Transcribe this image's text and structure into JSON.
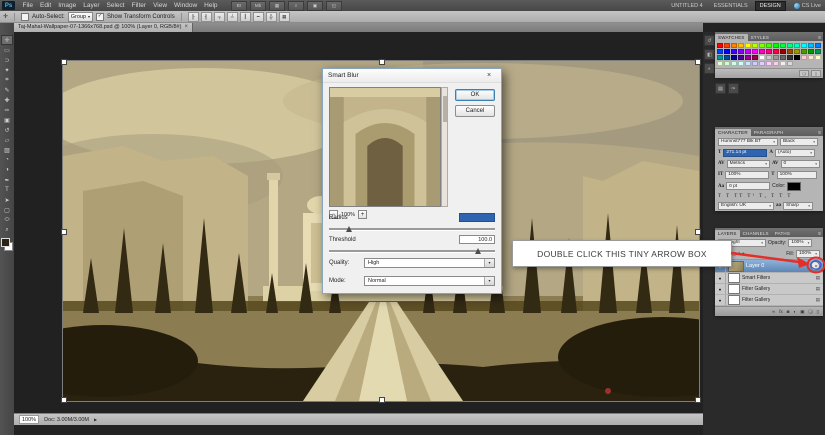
{
  "icons": {
    "eye": "●",
    "dropdown": "▾",
    "check": "✓",
    "smart_filter_toggle": "»",
    "panel_menu": "≡",
    "status_arrow": "▶",
    "slider_row_icon": "▤"
  },
  "app": {
    "logo": "Ps",
    "menus": [
      "File",
      "Edit",
      "Image",
      "Layer",
      "Select",
      "Filter",
      "View",
      "Window",
      "Help"
    ],
    "appbar_icons": [
      {
        "name": "bridge-icon",
        "glyph": "Br"
      },
      {
        "name": "mini-bridge-icon",
        "glyph": "Mb"
      },
      {
        "name": "view-extras-icon",
        "glyph": "▦"
      },
      {
        "name": "zoom-tool-icon",
        "glyph": "⌕"
      },
      {
        "name": "arrange-documents-icon",
        "glyph": "▣"
      },
      {
        "name": "screen-mode-icon",
        "glyph": "◱"
      }
    ],
    "workspace_tabs": [
      "UNTITLED 4",
      "ESSENTIALS",
      "DESIGN"
    ],
    "cs_live": "CS Live"
  },
  "options": {
    "auto_select_label": "Auto-Select:",
    "auto_select_value": "Group",
    "show_transform_label": "Show Transform Controls",
    "align_icons": [
      "╟",
      "╢",
      "╤",
      "╧",
      "┃",
      "━",
      "╬",
      "▦"
    ]
  },
  "doc_tab": {
    "title": "Taj-Mahal-Wallpaper-07-1366x768.psd @ 100% (Layer 0, RGB/8#)",
    "close": "×"
  },
  "tools": [
    {
      "name": "move-tool-icon",
      "glyph": "✛"
    },
    {
      "name": "rectangular-marquee-tool-icon",
      "glyph": "▭"
    },
    {
      "name": "lasso-tool-icon",
      "glyph": "⊃"
    },
    {
      "name": "quick-selection-tool-icon",
      "glyph": "✦"
    },
    {
      "name": "crop-tool-icon",
      "glyph": "⌗"
    },
    {
      "name": "eyedropper-tool-icon",
      "glyph": "✎"
    },
    {
      "name": "healing-brush-tool-icon",
      "glyph": "✚"
    },
    {
      "name": "brush-tool-icon",
      "glyph": "✑"
    },
    {
      "name": "clone-stamp-tool-icon",
      "glyph": "▣"
    },
    {
      "name": "history-brush-tool-icon",
      "glyph": "↺"
    },
    {
      "name": "eraser-tool-icon",
      "glyph": "▱"
    },
    {
      "name": "gradient-tool-icon",
      "glyph": "▨"
    },
    {
      "name": "blur-tool-icon",
      "glyph": "◔"
    },
    {
      "name": "dodge-tool-icon",
      "glyph": "◑"
    },
    {
      "name": "pen-tool-icon",
      "glyph": "✒"
    },
    {
      "name": "type-tool-icon",
      "glyph": "T"
    },
    {
      "name": "path-selection-tool-icon",
      "glyph": "➤"
    },
    {
      "name": "shape-tool-icon",
      "glyph": "▢"
    },
    {
      "name": "hand-tool-icon",
      "glyph": "⬭"
    },
    {
      "name": "zoom-tool-icon",
      "glyph": "⌕"
    }
  ],
  "dialog": {
    "title": "Smart Blur",
    "close": "×",
    "ok": "OK",
    "cancel": "Cancel",
    "zoom_out": "−",
    "zoom_value": "100%",
    "zoom_in": "+",
    "radius_label": "Radius",
    "radius_value": "",
    "threshold_label": "Threshold",
    "threshold_value": "100.0",
    "quality_label": "Quality:",
    "quality_value": "High",
    "mode_label": "Mode:",
    "mode_value": "Normal"
  },
  "annotation": {
    "text": "DOUBLE CLICK THIS TINY ARROW BOX"
  },
  "dock": {
    "collapsed_icons": [
      {
        "name": "history-panel-icon",
        "glyph": "↺"
      },
      {
        "name": "styles-panel-icon",
        "glyph": "◧"
      },
      {
        "name": "adjustments-panel-icon",
        "glyph": "◐"
      }
    ],
    "mini_buttons": [
      {
        "name": "tool-presets-panel-icon",
        "glyph": "▤"
      },
      {
        "name": "brush-panel-icon",
        "glyph": "✑"
      }
    ],
    "swatches": {
      "tabs": [
        "SWATCHES",
        "STYLES"
      ],
      "colors": [
        "#ff0000",
        "#ff4000",
        "#ff8000",
        "#ffbf00",
        "#ffff00",
        "#bfff00",
        "#80ff00",
        "#40ff00",
        "#00ff00",
        "#00ff40",
        "#00ff80",
        "#00ffbf",
        "#00ffff",
        "#00bfff",
        "#0080ff",
        "#0040ff",
        "#0000ff",
        "#4000ff",
        "#8000ff",
        "#bf00ff",
        "#ff00ff",
        "#ff00bf",
        "#ff0080",
        "#ff0040",
        "#990000",
        "#994c00",
        "#999900",
        "#4c9900",
        "#009900",
        "#00994c",
        "#009999",
        "#004c99",
        "#000099",
        "#4c0099",
        "#990099",
        "#99004c",
        "#ffffff",
        "#cccccc",
        "#999999",
        "#666666",
        "#333333",
        "#000000",
        "#ffcccc",
        "#ffe5cc",
        "#ffffcc",
        "#e5ffcc",
        "#ccffcc",
        "#ccffe5",
        "#ccffff",
        "#cce5ff",
        "#ccccff",
        "#e5ccff",
        "#ffccff",
        "#ffcce5",
        "#f0f0f0",
        "#d9d9d9"
      ]
    },
    "character": {
      "tabs": [
        "CHARACTER",
        "PARAGRAPH"
      ],
      "font_family": "Humnst777 Blk BT",
      "font_style": "Black",
      "size_icon": "T",
      "size": "271.14 pt",
      "leading_icon": "A",
      "leading": "(Auto)",
      "kerning_icon": "AV",
      "kerning": "Metrics",
      "tracking_icon": "AV",
      "tracking": "0",
      "vscale_icon": "IT",
      "v_scale": "100%",
      "hscale_icon": "T",
      "h_scale": "100%",
      "baseline_icon": "Aa",
      "baseline": "0 pt",
      "color_label": "Color:",
      "style_glyphs": "T T TT T¹ T₁ T T T",
      "language": "English: UK",
      "aa_label": "aa",
      "anti_alias": "Sharp"
    },
    "layers": {
      "tabs": [
        "LAYERS",
        "CHANNELS",
        "PATHS"
      ],
      "blend_mode": "Pin Light",
      "opacity_label": "Opacity:",
      "opacity_value": "100%",
      "lock_label": "Lock:",
      "lock_icons": [
        "▢",
        "✛",
        "●"
      ],
      "fill_label": "Fill:",
      "fill_value": "100%",
      "layer_name": "Layer 0",
      "items": [
        {
          "name": "Smart Filters"
        },
        {
          "name": "Filter Gallery"
        },
        {
          "name": "Filter Gallery"
        }
      ],
      "footer_icons": [
        {
          "name": "link-layers-icon",
          "glyph": "∞"
        },
        {
          "name": "layer-style-icon",
          "glyph": "fx"
        },
        {
          "name": "layer-mask-icon",
          "glyph": "◙"
        },
        {
          "name": "adjustment-layer-icon",
          "glyph": "◐"
        },
        {
          "name": "layer-group-icon",
          "glyph": "▣"
        },
        {
          "name": "new-layer-icon",
          "glyph": "❏"
        },
        {
          "name": "delete-layer-icon",
          "glyph": "▯"
        }
      ]
    }
  },
  "statusbar": {
    "zoom": "100%",
    "doc": "Doc: 3.00M/3.00M"
  }
}
